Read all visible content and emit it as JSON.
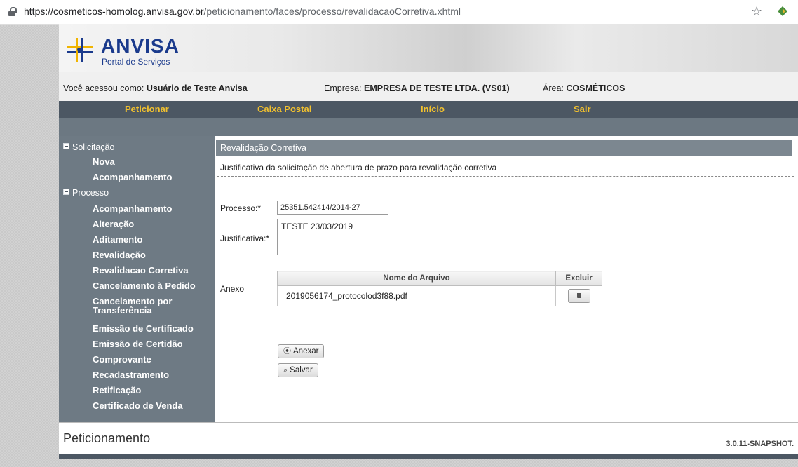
{
  "browser": {
    "url_host": "https://cosmeticos-homolog.anvisa.gov.br",
    "url_path": "/peticionamento/faces/processo/revalidacaoCorretiva.xhtml",
    "icons": [
      "lock-icon",
      "star-icon",
      "extension-icon"
    ]
  },
  "header": {
    "logo_title": "ANVISA",
    "logo_subtitle": "Portal de Serviços"
  },
  "userbar": {
    "user_label": "Você acessou como:",
    "user_value": "Usuário de Teste Anvisa",
    "company_label": "Empresa:",
    "company_value": "EMPRESA DE TESTE LTDA. (VS01)",
    "area_label": "Área:",
    "area_value": "COSMÉTICOS"
  },
  "nav": {
    "items": [
      "Peticionar",
      "Caixa Postal",
      "Início",
      "Sair"
    ],
    "color": "#f2c12e"
  },
  "sidebar": {
    "sections": [
      {
        "label": "Solicitação",
        "items": [
          "Nova",
          "Acompanhamento"
        ]
      },
      {
        "label": "Processo",
        "items": [
          "Acompanhamento",
          "Alteração",
          "Aditamento",
          "Revalidação",
          "Revalidacao Corretiva",
          "Cancelamento à Pedido",
          "Cancelamento por",
          "Transferência",
          "Emissão de Certificado",
          "Emissão de Certidão",
          "Comprovante",
          "Recadastramento",
          "Retificação",
          "Certificado de Venda"
        ]
      }
    ]
  },
  "main": {
    "section_title": "Revalidação Corretiva",
    "subtitle": "Justificativa da solicitação de abertura de prazo para revalidação corretiva",
    "processo_label": "Processo:*",
    "processo_value": "25351.542414/2014-27",
    "justificativa_label": "Justificativa:*",
    "justificativa_value": "TESTE 23/03/2019",
    "anexo_label": "Anexo",
    "table": {
      "headers": [
        "Nome do Arquivo",
        "Excluir"
      ],
      "rows": [
        [
          "2019056174_protocolod3f88.pdf",
          ""
        ]
      ]
    },
    "anexar_label": "Anexar",
    "salvar_label": "Salvar"
  },
  "footer": {
    "app_name": "Peticionamento",
    "version": "3.0.11-SNAPSHOT."
  }
}
